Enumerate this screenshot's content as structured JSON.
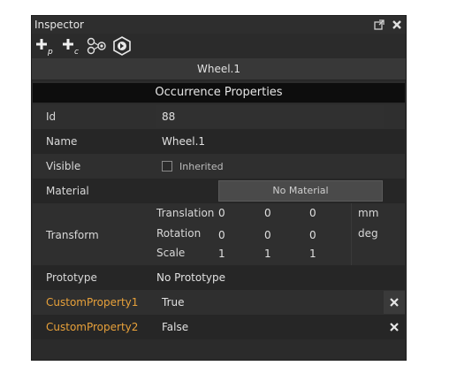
{
  "window": {
    "title": "Inspector",
    "popout_icon": "popout-icon",
    "close_icon": "close-icon"
  },
  "toolbar": {
    "tools": [
      {
        "name": "add-property-icon",
        "label": "+p"
      },
      {
        "name": "add-component-icon",
        "label": "+c"
      },
      {
        "name": "hierarchy-icon",
        "label": ""
      },
      {
        "name": "target-icon",
        "label": ""
      }
    ]
  },
  "occurrence_name": "Wheel.1",
  "section_title": "Occurrence Properties",
  "properties": {
    "id": {
      "label": "Id",
      "value": "88"
    },
    "name": {
      "label": "Name",
      "value": "Wheel.1"
    },
    "visible": {
      "label": "Visible",
      "checkbox_label": "Inherited",
      "checked": false
    },
    "material": {
      "label": "Material",
      "button": "No Material"
    },
    "transform": {
      "label": "Transform",
      "rows": [
        {
          "label": "Translation",
          "values": [
            "0",
            "0",
            "0"
          ],
          "unit": "mm"
        },
        {
          "label": "Rotation",
          "values": [
            "0",
            "0",
            "0"
          ],
          "unit": "deg"
        },
        {
          "label": "Scale",
          "values": [
            "1",
            "1",
            "1"
          ],
          "unit": ""
        }
      ]
    },
    "prototype": {
      "label": "Prototype",
      "value": "No Prototype"
    },
    "custom": [
      {
        "label": "CustomProperty1",
        "value": "True"
      },
      {
        "label": "CustomProperty2",
        "value": "False"
      }
    ]
  },
  "colors": {
    "panel_bg": "#2b2b2b",
    "header_bg": "#0d0d0d",
    "custom_label": "#e8a13a"
  }
}
